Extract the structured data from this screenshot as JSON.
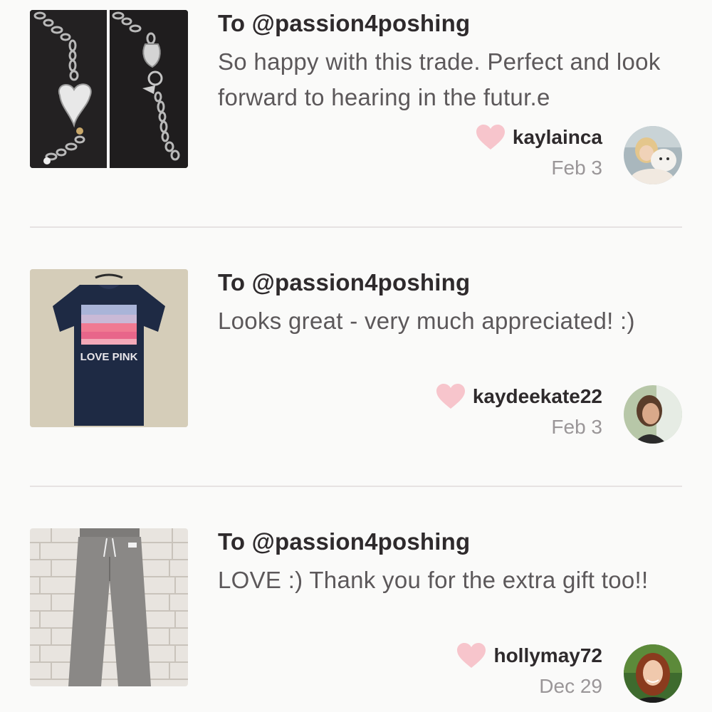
{
  "feedback": [
    {
      "to": "To @passion4poshing",
      "message": "So happy with this trade. Perfect and look forward to hearing in the futur.e",
      "username": "kaylainca",
      "date": "Feb 3",
      "thumb_icon": "bracelet-photo",
      "avatar_icon": "user-with-dog-avatar"
    },
    {
      "to": "To @passion4poshing",
      "message": "Looks great - very much appreciated! :)",
      "username": "kaydeekate22",
      "date": "Feb 3",
      "thumb_icon": "tshirt-photo",
      "thumb_text": "LOVE PINK",
      "avatar_icon": "user-selfie-avatar"
    },
    {
      "to": "To @passion4poshing",
      "message": "LOVE :) Thank you for the extra gift too!!",
      "username": "hollymay72",
      "date": "Dec 29",
      "thumb_icon": "sweatpants-photo",
      "avatar_icon": "user-redhead-avatar"
    }
  ],
  "colors": {
    "background": "#fafaf9",
    "heart": "#f7c5cc",
    "text_dark": "#2e2a2c",
    "text_body": "#5c585a",
    "text_muted": "#9a9698",
    "divider": "#e6e2e2"
  }
}
